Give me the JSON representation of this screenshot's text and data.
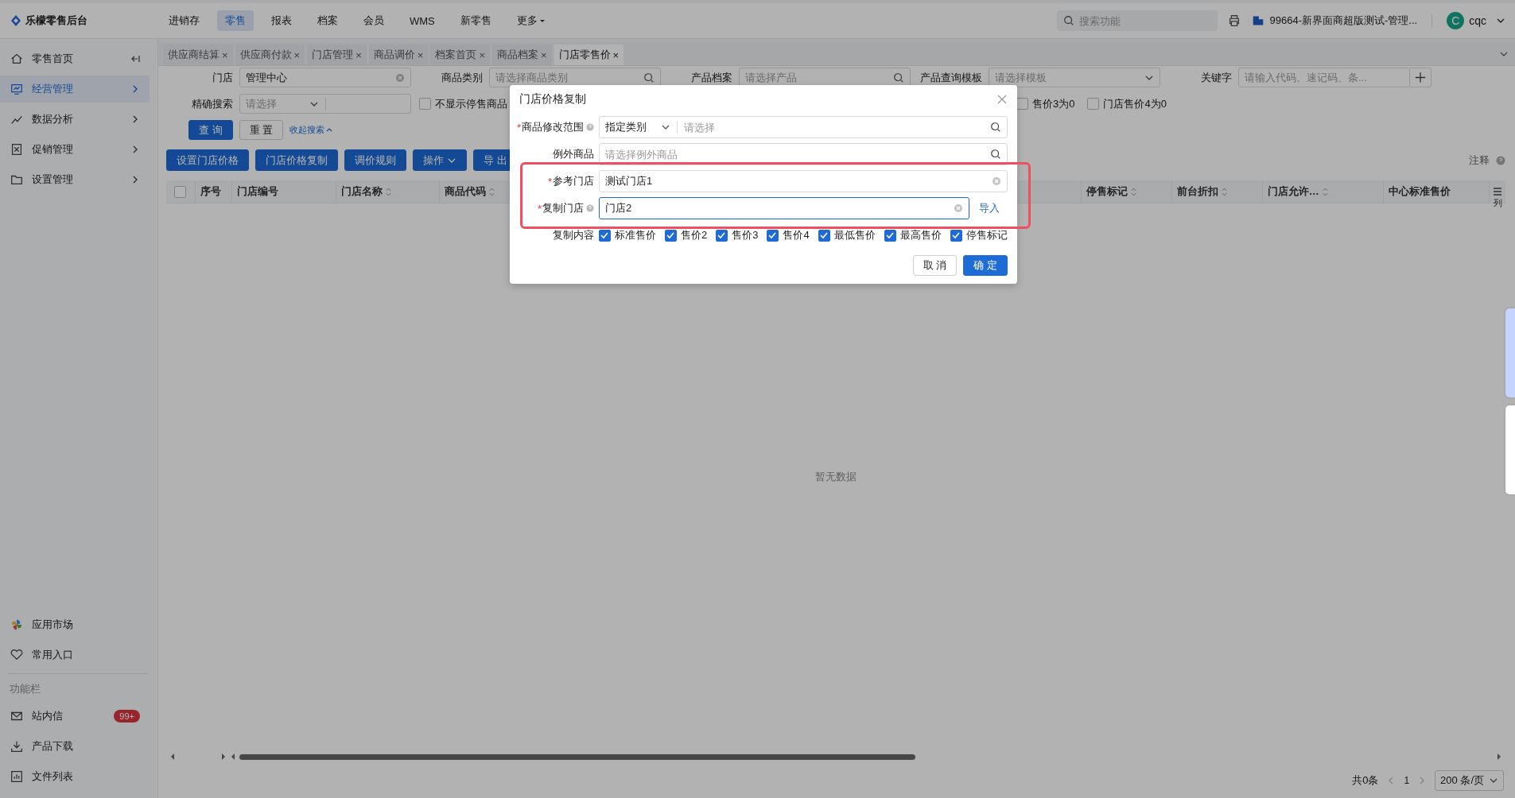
{
  "app": {
    "name": "乐檬零售后台"
  },
  "top_nav": [
    {
      "label": "进销存",
      "selected": false,
      "dropdown": false
    },
    {
      "label": "零售",
      "selected": true,
      "dropdown": false
    },
    {
      "label": "报表",
      "selected": false,
      "dropdown": false
    },
    {
      "label": "档案",
      "selected": false,
      "dropdown": false
    },
    {
      "label": "会员",
      "selected": false,
      "dropdown": false
    },
    {
      "label": "WMS",
      "selected": false,
      "dropdown": false
    },
    {
      "label": "新零售",
      "selected": false,
      "dropdown": false
    },
    {
      "label": "更多",
      "selected": false,
      "dropdown": true
    }
  ],
  "search": {
    "placeholder": "搜索功能"
  },
  "org": "99664-新界面商超版测试-管理...",
  "user": {
    "initial": "C",
    "name": "cqc"
  },
  "sidebar": {
    "items": [
      {
        "label": "零售首页",
        "selected": false,
        "arrow": false
      },
      {
        "label": "经营管理",
        "selected": true,
        "arrow": true
      },
      {
        "label": "数据分析",
        "selected": false,
        "arrow": true
      },
      {
        "label": "促销管理",
        "selected": false,
        "arrow": true
      },
      {
        "label": "设置管理",
        "selected": false,
        "arrow": true
      }
    ],
    "bottom_items": [
      {
        "label": "应用市场"
      },
      {
        "label": "常用入口"
      }
    ],
    "section_title": "功能栏",
    "tools": [
      {
        "label": "站内信",
        "badge": "99+"
      },
      {
        "label": "产品下载"
      },
      {
        "label": "文件列表"
      }
    ]
  },
  "tabs": [
    {
      "label": "供应商结算",
      "close": "×",
      "selected": false
    },
    {
      "label": "供应商付款",
      "close": "×",
      "selected": false
    },
    {
      "label": "门店管理",
      "close": "×",
      "selected": false
    },
    {
      "label": "商品调价",
      "close": "×",
      "selected": false
    },
    {
      "label": "档案首页",
      "close": "×",
      "selected": false
    },
    {
      "label": "商品档案",
      "close": "×",
      "selected": false
    },
    {
      "label": "门店零售价",
      "close": "×",
      "selected": true
    }
  ],
  "filters": {
    "row1": [
      {
        "label": "门店",
        "value": "管理中心",
        "kind": "clear"
      },
      {
        "label": "商品类别",
        "placeholder": "请选择商品类别",
        "kind": "search"
      },
      {
        "label": "产品档案",
        "placeholder": "请选择产品",
        "kind": "search"
      },
      {
        "label": "产品查询模板",
        "placeholder": "请选择模板",
        "kind": "select"
      },
      {
        "label": "关键字",
        "placeholder": "请输入代码、速记码、条...",
        "kind": "plus"
      }
    ],
    "exact": {
      "label": "精确搜索",
      "placeholder": "请选择"
    },
    "checks": [
      {
        "label": "不显示停售商品",
        "checked": false
      },
      {
        "label": "售价3为0",
        "checked": false
      },
      {
        "label": "门店售价4为0",
        "checked": false
      }
    ],
    "query": "查 询",
    "reset": "重 置",
    "collapse": "收起搜索"
  },
  "actions": [
    {
      "label": "设置门店价格",
      "dropdown": false
    },
    {
      "label": "门店价格复制",
      "dropdown": false
    },
    {
      "label": "调价规则",
      "dropdown": false
    },
    {
      "label": "操作",
      "dropdown": true
    },
    {
      "label": "导 出",
      "dropdown": false
    }
  ],
  "note": "注释",
  "table": {
    "select_all": {
      "checked": false
    },
    "columns": [
      {
        "label": "序号",
        "sortable": false
      },
      {
        "label": "门店编号",
        "sortable": false
      },
      {
        "label": "门店名称",
        "sortable": true
      },
      {
        "label": "商品代码",
        "sortable": true
      },
      {
        "label": "停售标记",
        "sortable": true
      },
      {
        "label": "前台折扣",
        "sortable": true
      },
      {
        "label": "门店允许…",
        "sortable": true
      },
      {
        "label": "中心标准售价",
        "sortable": false
      }
    ],
    "settings": "列",
    "empty": "暂无数据"
  },
  "pagination": {
    "total": "共0条",
    "page": "1",
    "size": "200 条/页"
  },
  "modal": {
    "title": "门店价格复制",
    "fields": [
      {
        "label": "商品修改范围",
        "mark": "*",
        "help": true,
        "kind": "scope",
        "select": "指定类别",
        "placeholder": "请选择"
      },
      {
        "label": "例外商品",
        "help": false,
        "kind": "search",
        "placeholder": "请选择例外商品"
      },
      {
        "label": "参考门店",
        "mark": "*",
        "help": false,
        "kind": "clear",
        "value": "测试门店1"
      },
      {
        "label": "复制门店",
        "mark": "*",
        "help": true,
        "kind": "import",
        "value": "门店2",
        "link": "导入"
      }
    ],
    "copy_label": "复制内容",
    "options": [
      {
        "label": "标准售价",
        "checked": true
      },
      {
        "label": "售价2",
        "checked": true
      },
      {
        "label": "售价3",
        "checked": true
      },
      {
        "label": "售价4",
        "checked": true
      },
      {
        "label": "最低售价",
        "checked": true
      },
      {
        "label": "最高售价",
        "checked": true
      },
      {
        "label": "停售标记",
        "checked": true
      }
    ],
    "cancel": "取 消",
    "ok": "确 定"
  }
}
